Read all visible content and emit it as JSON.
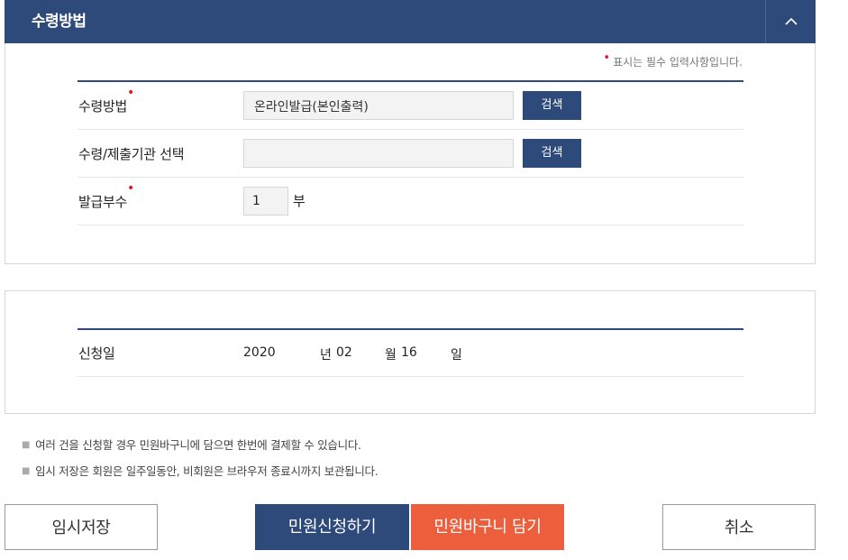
{
  "section": {
    "title": "수령방법",
    "collapse_icon": "chevron-up-icon"
  },
  "required_note": "표시는 필수 입력사항입니다.",
  "form": {
    "receive_method": {
      "label": "수령방법",
      "required": true,
      "value": "온라인발급(본인출력)",
      "button": "검색"
    },
    "institution": {
      "label": "수령/제출기관 선택",
      "value": "",
      "button": "검색"
    },
    "copies": {
      "label": "발급부수",
      "required": true,
      "value": "1",
      "unit": "부"
    }
  },
  "application_date": {
    "label": "신청일",
    "year": "2020",
    "year_unit": "년",
    "month": "02",
    "month_unit": "월",
    "day": "16",
    "day_unit": "일"
  },
  "notes": [
    "여러 건을 신청할 경우 민원바구니에 담으면 한번에 결제할 수 있습니다.",
    "임시 저장은 회원은 일주일동안, 비회원은 브라우저 종료시까지 보관됩니다."
  ],
  "buttons": {
    "save": "임시저장",
    "apply": "민원신청하기",
    "cart": "민원바구니 담기",
    "cancel": "취소"
  },
  "colors": {
    "primary": "#2e4a7a",
    "accent": "#ec5e3c",
    "required": "#e8151b"
  }
}
